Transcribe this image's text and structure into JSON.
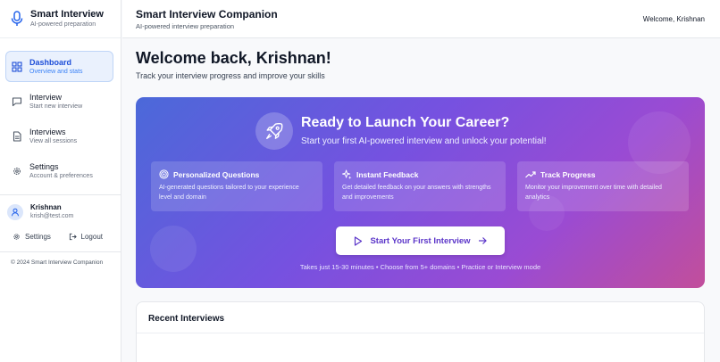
{
  "brand": {
    "title": "Smart Interview",
    "subtitle": "AI-powered preparation",
    "icon": "microphone-icon"
  },
  "nav": {
    "items": [
      {
        "label": "Dashboard",
        "desc": "Overview and stats",
        "icon": "dashboard-grid-icon",
        "active": true
      },
      {
        "label": "Interview",
        "desc": "Start new interview",
        "icon": "chat-bubble-icon",
        "active": false
      },
      {
        "label": "Interviews",
        "desc": "View all sessions",
        "icon": "document-icon",
        "active": false
      },
      {
        "label": "Settings",
        "desc": "Account & preferences",
        "icon": "gear-icon",
        "active": false
      }
    ]
  },
  "user": {
    "name": "Krishnan",
    "email": "krish@test.com",
    "settings_label": "Settings",
    "logout_label": "Logout"
  },
  "sidebar_footer": "© 2024 Smart Interview Companion",
  "header": {
    "title": "Smart Interview Companion",
    "subtitle": "AI-powered interview preparation",
    "welcome": "Welcome, Krishnan"
  },
  "main": {
    "heading": "Welcome back, Krishnan!",
    "subheading": "Track your interview progress and improve your skills"
  },
  "hero": {
    "title": "Ready to Launch Your Career?",
    "subtitle": "Start your first AI-powered interview and unlock your potential!",
    "features": [
      {
        "title": "Personalized Questions",
        "desc": "AI-generated questions tailored to your experience level and domain",
        "icon": "target-icon"
      },
      {
        "title": "Instant Feedback",
        "desc": "Get detailed feedback on your answers with strengths and improvements",
        "icon": "sparkles-icon"
      },
      {
        "title": "Track Progress",
        "desc": "Monitor your improvement over time with detailed analytics",
        "icon": "trending-up-icon"
      }
    ],
    "cta_label": "Start Your First Interview",
    "note": "Takes just 15-30 minutes • Choose from 5+ domains • Practice or Interview mode"
  },
  "recent": {
    "title": "Recent Interviews"
  },
  "colors": {
    "accent": "#2563eb",
    "hero_start": "#4b69d9",
    "hero_end": "#c24e9b",
    "cta_text": "#5b35c9"
  }
}
